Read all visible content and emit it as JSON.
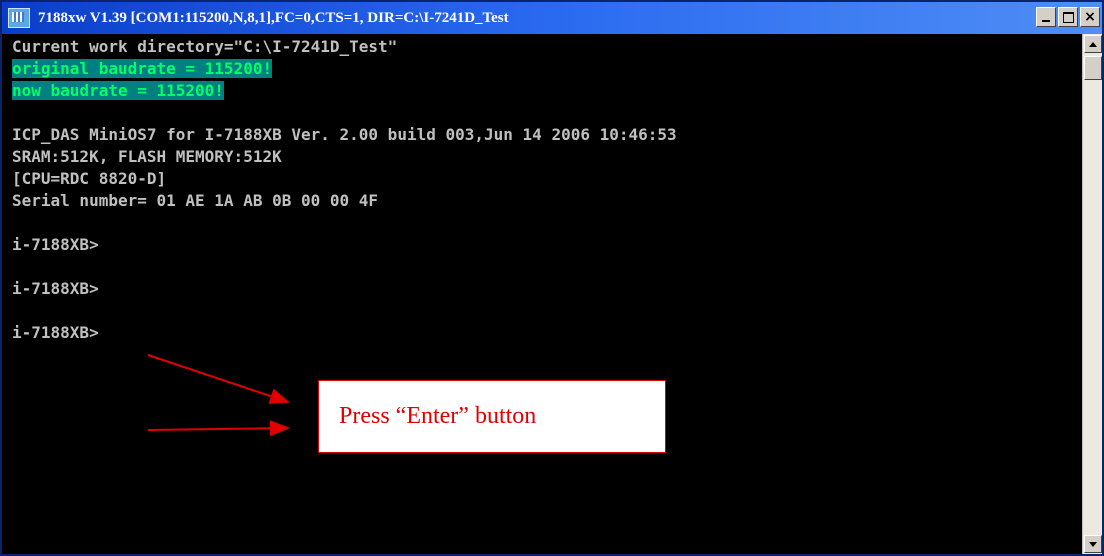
{
  "window": {
    "title": "7188xw V1.39 [COM1:115200,N,8,1],FC=0,CTS=1, DIR=C:\\I-7241D_Test",
    "icon": "terminal-app-icon",
    "controls": {
      "minimize": "minimize-icon",
      "maximize": "maximize-icon",
      "close_label": "×"
    }
  },
  "console": {
    "lines": [
      "Current work directory=\"C:\\I-7241D_Test\"",
      "original baudrate = 115200!",
      "now baudrate = 115200!",
      "ICP_DAS MiniOS7 for I-7188XB Ver. 2.00 build 003,Jun 14 2006 10:46:53",
      "SRAM:512K, FLASH MEMORY:512K",
      "[CPU=RDC 8820-D]",
      "Serial number= 01 AE 1A AB 0B 00 00 4F",
      "i-7188XB>",
      "i-7188XB>",
      "i-7188XB>"
    ]
  },
  "annotation": {
    "text": "Press “Enter” button",
    "color": "#e00000"
  },
  "colors": {
    "titlebar_start": "#0a3ec9",
    "highlight_bg": "#008080",
    "highlight_fg": "#00ff66",
    "console_text": "#c0c0c0"
  }
}
